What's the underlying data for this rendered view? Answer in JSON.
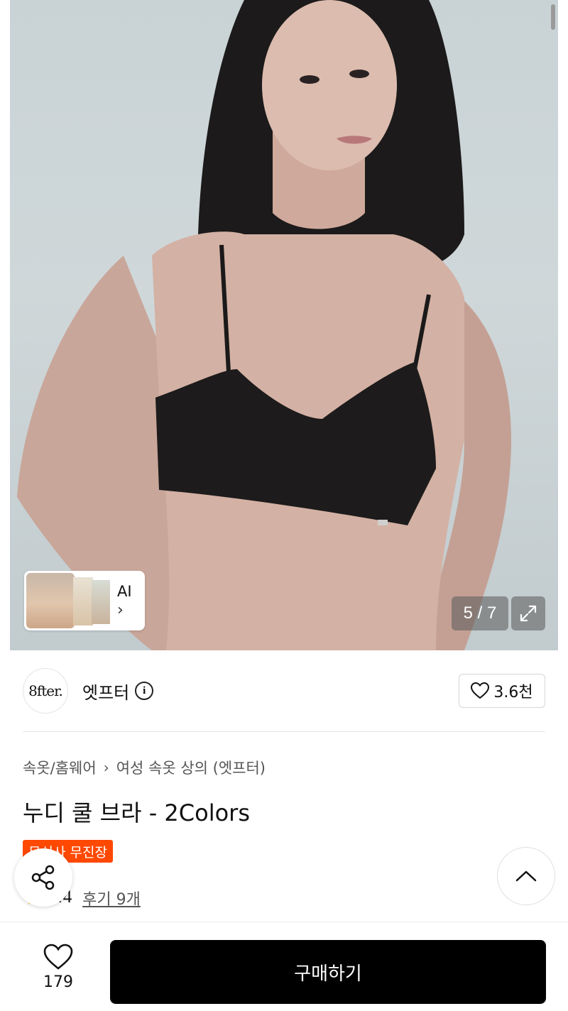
{
  "hero": {
    "ai_label": "AI",
    "ai_chevron": "›",
    "counter": "5 / 7",
    "expand_icon": "expand-icon"
  },
  "brand": {
    "logo_text": "8fter.",
    "name": "엣프터",
    "like_count": "3.6천"
  },
  "product": {
    "breadcrumb": [
      "속옷/홈웨어",
      "여성 속옷 상의 (엣프터)"
    ],
    "breadcrumb_separator": "›",
    "title": "누디 쿨 브라 - 2Colors",
    "badge": "무신사 무진장",
    "rating": "4.4",
    "reviews": "후기 9개"
  },
  "bottom": {
    "wish_count": "179",
    "buy_label": "구매하기"
  },
  "colors": {
    "badge": "#ff4800",
    "star": "#ffb400",
    "buy_button": "#000000"
  }
}
